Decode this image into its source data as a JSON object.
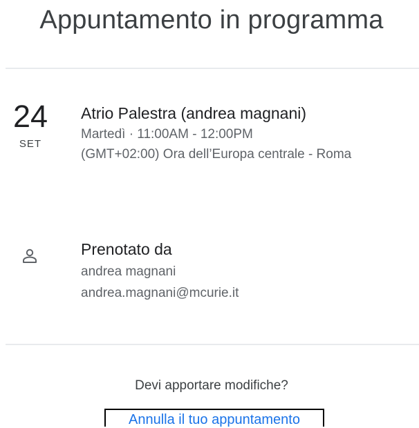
{
  "page": {
    "title": "Appuntamento in programma"
  },
  "appointment": {
    "day": "24",
    "month": "SET",
    "title": "Atrio Palestra (andrea magnani)",
    "time": "Martedì · 11:00AM - 12:00PM",
    "timezone": "(GMT+02:00) Ora dell’Europa centrale - Roma"
  },
  "booking": {
    "icon": "person-icon",
    "heading": "Prenotato da",
    "name": "andrea magnani",
    "email": "andrea.magnani@mcurie.it"
  },
  "footer": {
    "prompt": "Devi apportare modifiche?",
    "cancel_link": "Annulla il tuo appuntamento",
    "link_color": "#1a73e8"
  }
}
